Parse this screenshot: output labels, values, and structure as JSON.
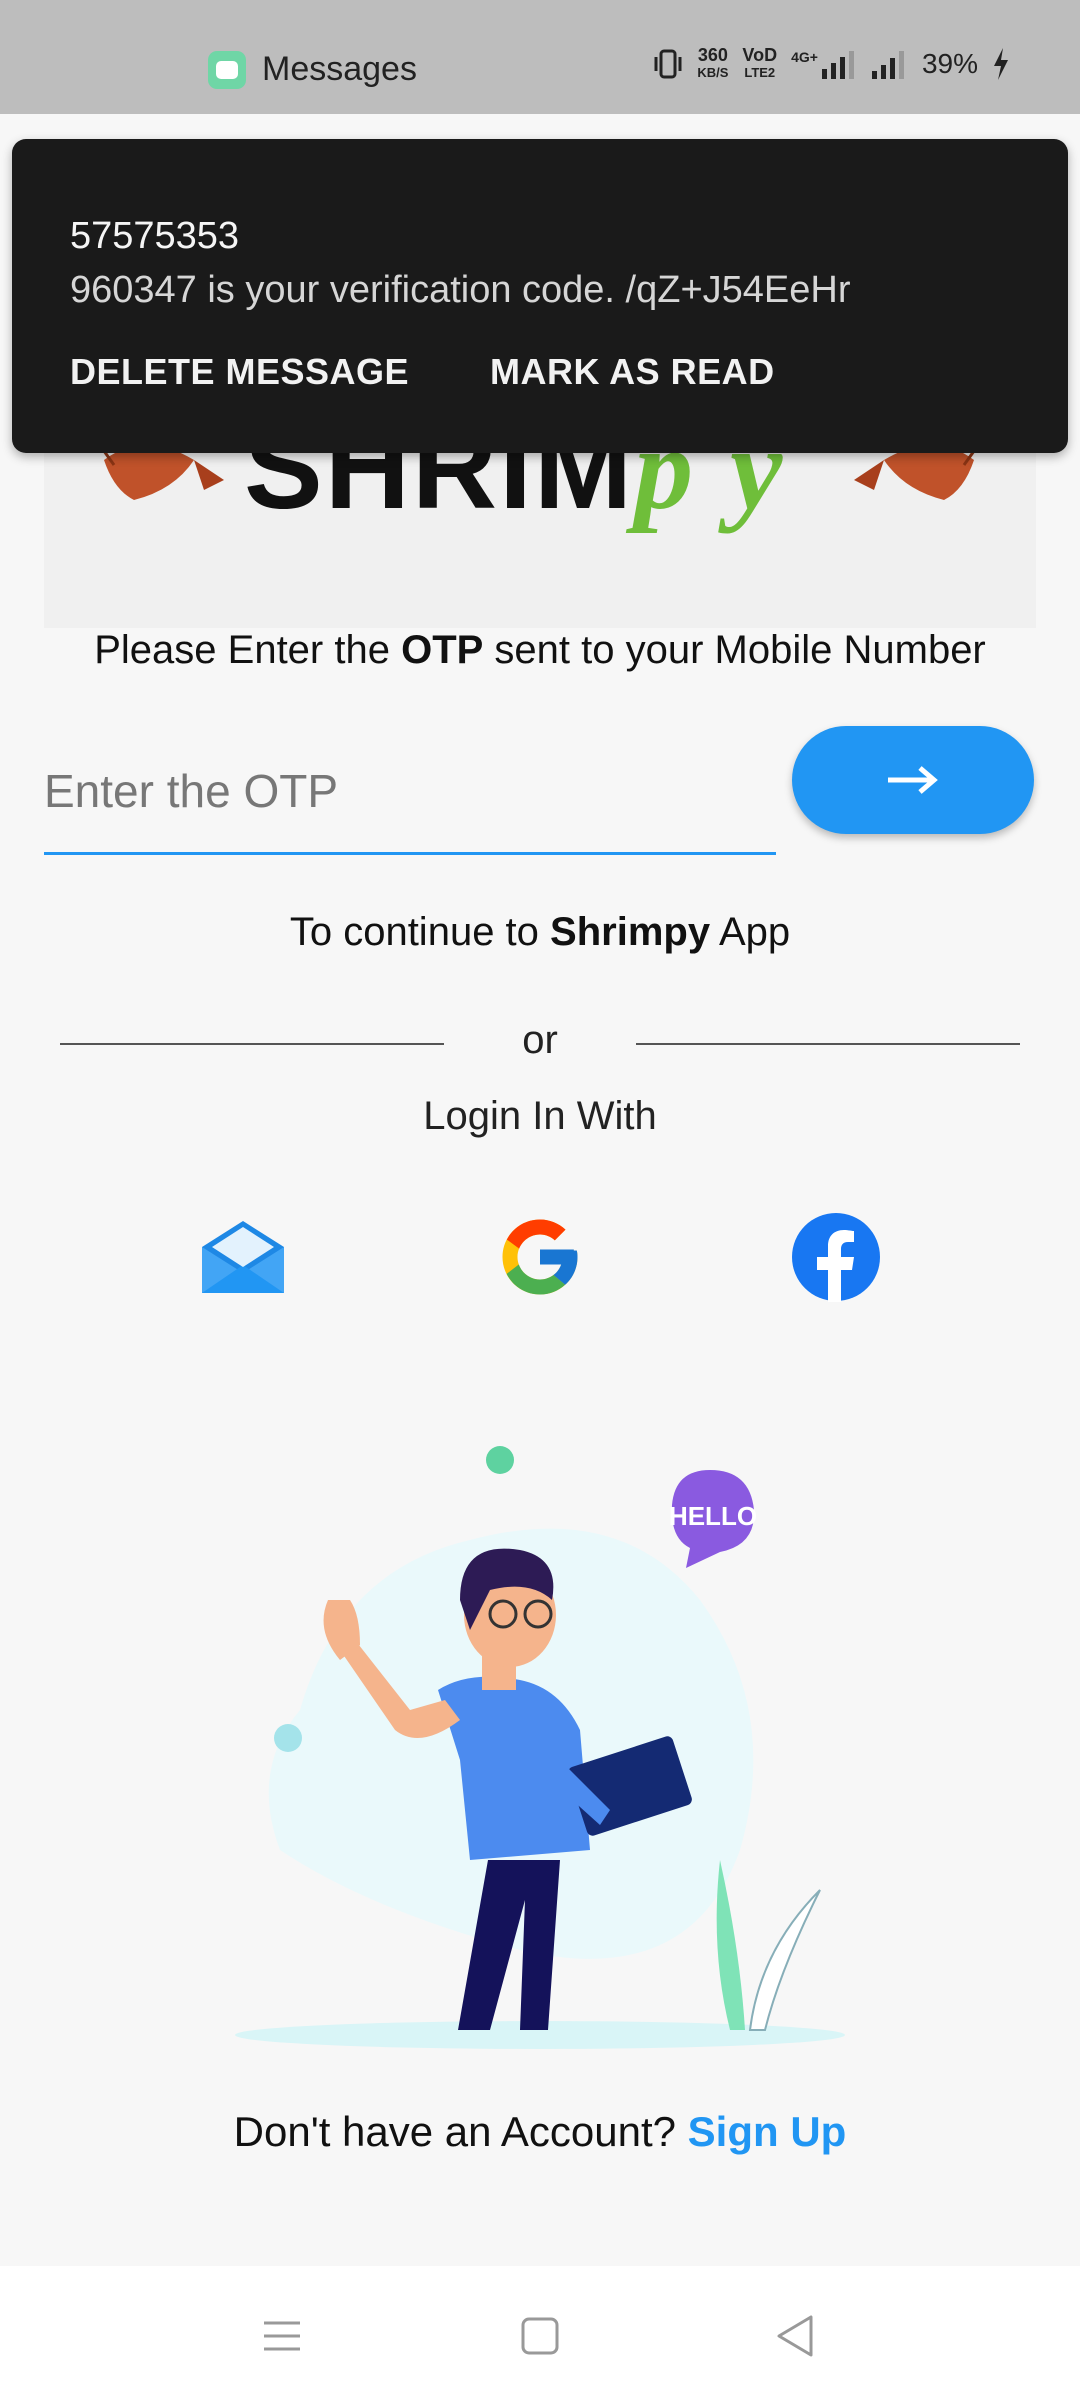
{
  "status_bar": {
    "app_name": "Messages",
    "speed_value": "360",
    "speed_unit": "KB/S",
    "volte_top": "VoD",
    "volte_bottom": "LTE2",
    "network": "4G+",
    "battery": "39%"
  },
  "notification": {
    "sender": "57575353",
    "body": "960347 is your verification code. /qZ+J54EeHr",
    "action_delete": "DELETE MESSAGE",
    "action_mark_read": "MARK AS READ"
  },
  "otp": {
    "prompt_pre": "Please Enter the ",
    "prompt_bold": "OTP",
    "prompt_post": " sent to your Mobile Number",
    "placeholder": "Enter the OTP",
    "next_icon": "arrow-right-icon"
  },
  "continue": {
    "pre": "To continue to ",
    "bold": "Shrimpy",
    "post": " App"
  },
  "divider": {
    "or": "or"
  },
  "login_with": "Login In With",
  "social": [
    "mail-icon",
    "google-icon",
    "facebook-icon"
  ],
  "illustration": {
    "bubble_text": "HELLO"
  },
  "signup": {
    "text": "Don't have an Account? ",
    "link": "Sign Up"
  },
  "colors": {
    "accent": "#2196f3",
    "notification_bg": "#1a1a1a",
    "status_bar_bg": "#bdbdbd"
  }
}
